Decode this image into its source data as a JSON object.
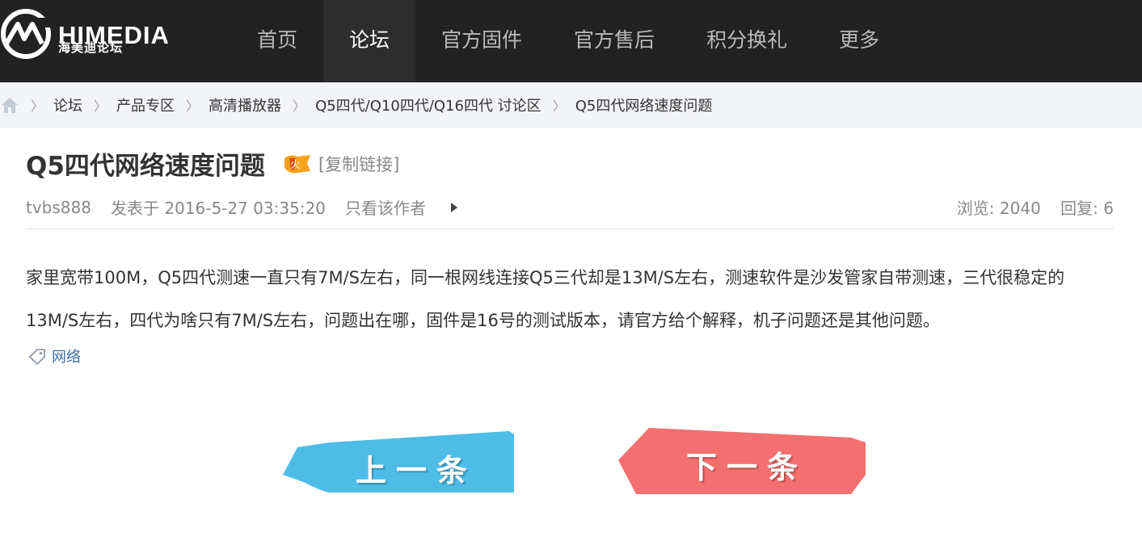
{
  "header": {
    "logo_text": "HIMEDIA",
    "logo_sub": "海美迪论坛",
    "nav": [
      {
        "label": "首页"
      },
      {
        "label": "论坛"
      },
      {
        "label": "官方固件"
      },
      {
        "label": "官方售后"
      },
      {
        "label": "积分换礼"
      },
      {
        "label": "更多"
      }
    ],
    "active_nav": "论坛"
  },
  "breadcrumb": {
    "home_icon": "home-icon",
    "items": [
      {
        "label": "论坛"
      },
      {
        "label": "产品专区"
      },
      {
        "label": "高清播放器"
      },
      {
        "label": "Q5四代/Q10四代/Q16四代 讨论区"
      },
      {
        "label": "Q5四代网络速度问题"
      }
    ],
    "separator": "〉"
  },
  "post": {
    "title": "Q5四代网络速度问题",
    "hot_icon": "fire-icon",
    "copy_link": "[复制链接]",
    "author": "tvbs888",
    "posted": "发表于 2016-5-27 03:35:20",
    "only_author": "只看该作者",
    "views_label": "浏览:",
    "views": "2040",
    "replies_label": "回复:",
    "replies": "6",
    "body": "家里宽带100M，Q5四代测速一直只有7M/S左右，同一根网线连接Q5三代却是13M/S左右，测速软件是沙发管家自带测速，三代很稳定的13M/S左右，四代为啥只有7M/S左右，问题出在哪，固件是16号的测试版本，请官方给个解释，机子问题还是其他问题。",
    "tag": "网络"
  },
  "pager": {
    "prev_label": "上一条",
    "next_label": "下一条",
    "prev_color": "#4dbde8",
    "next_color": "#f46f6f"
  },
  "colors": {
    "topbar": "#222222",
    "breadcrumb_bg": "#f3f4f7"
  }
}
